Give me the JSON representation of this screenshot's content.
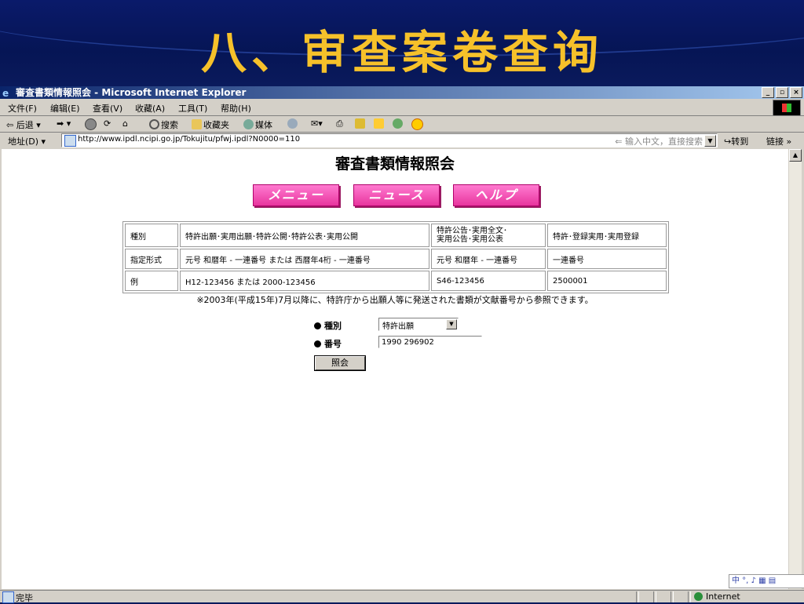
{
  "slide": {
    "title": "八、审查案卷查询"
  },
  "window": {
    "title": "審査書類情報照会 - Microsoft Internet Explorer",
    "controls": [
      "_",
      "▫",
      "×"
    ]
  },
  "menu": [
    "文件(F)",
    "编辑(E)",
    "查看(V)",
    "收藏(A)",
    "工具(T)",
    "帮助(H)"
  ],
  "toolbar": {
    "back": "后退",
    "search": "搜索",
    "favorites": "收藏夹",
    "media": "媒体"
  },
  "address": {
    "label": "地址(D)",
    "url": "http://www.ipdl.ncipi.go.jp/Tokujitu/pfwj.ipdl?N0000=110",
    "hint": "输入中文，直接搜索",
    "go": "转到",
    "links": "链接"
  },
  "page": {
    "heading": "審査書類情報照会",
    "nav_buttons": [
      "メニュー",
      "ニュース",
      "ヘルプ"
    ],
    "table": [
      [
        "種別",
        "特許出願･実用出願･特許公開･特許公表･実用公開",
        "特許公告･実用全文･\n実用公告･実用公表",
        "特許･登録実用･実用登録"
      ],
      [
        "指定形式",
        "元号 和暦年 - 一連番号 または 西暦年4桁 - 一連番号",
        "元号 和暦年 - 一連番号",
        "一連番号"
      ],
      [
        "例",
        "H12-123456 または 2000-123456",
        "S46-123456",
        "2500001"
      ]
    ],
    "note": "※2003年(平成15年)7月以降に、特許庁から出願人等に発送された書類が文献番号から参照できます。",
    "form": {
      "type_label": "種別",
      "type_value": "特許出願",
      "number_label": "番号",
      "number_value": "1990 296902",
      "submit": "照会"
    }
  },
  "ime": "中 °, ♪ ▦ ▤",
  "status": {
    "text": "完毕",
    "zone": "Internet"
  }
}
